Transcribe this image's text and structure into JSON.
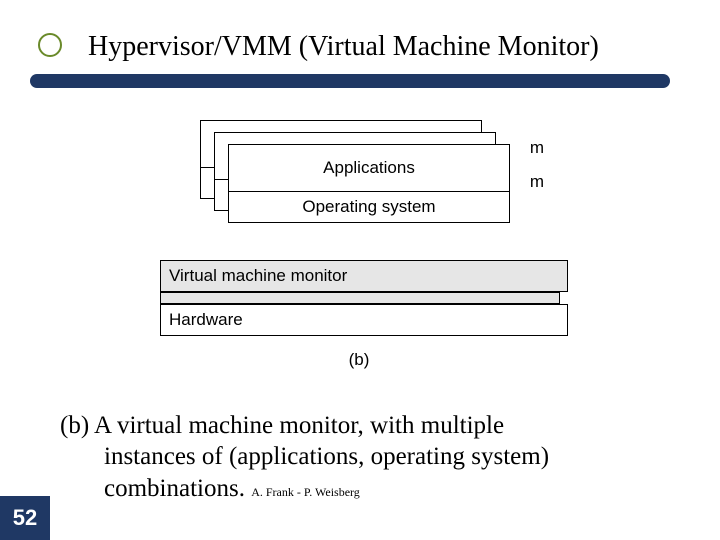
{
  "title": "Hypervisor/VMM (Virtual Machine Monitor)",
  "diagram": {
    "applications_label": "Applications",
    "os_label": "Operating system",
    "stray_m_upper": "m",
    "stray_m_lower": "m",
    "vmm_label": "Virtual machine monitor",
    "hardware_label": "Hardware",
    "subcaption": "(b)"
  },
  "caption": {
    "line1": "(b) A virtual machine monitor, with multiple",
    "line2": "instances of (applications, operating system)",
    "line3": "combinations."
  },
  "attribution": "A. Frank - P. Weisberg",
  "slide_number": "52"
}
